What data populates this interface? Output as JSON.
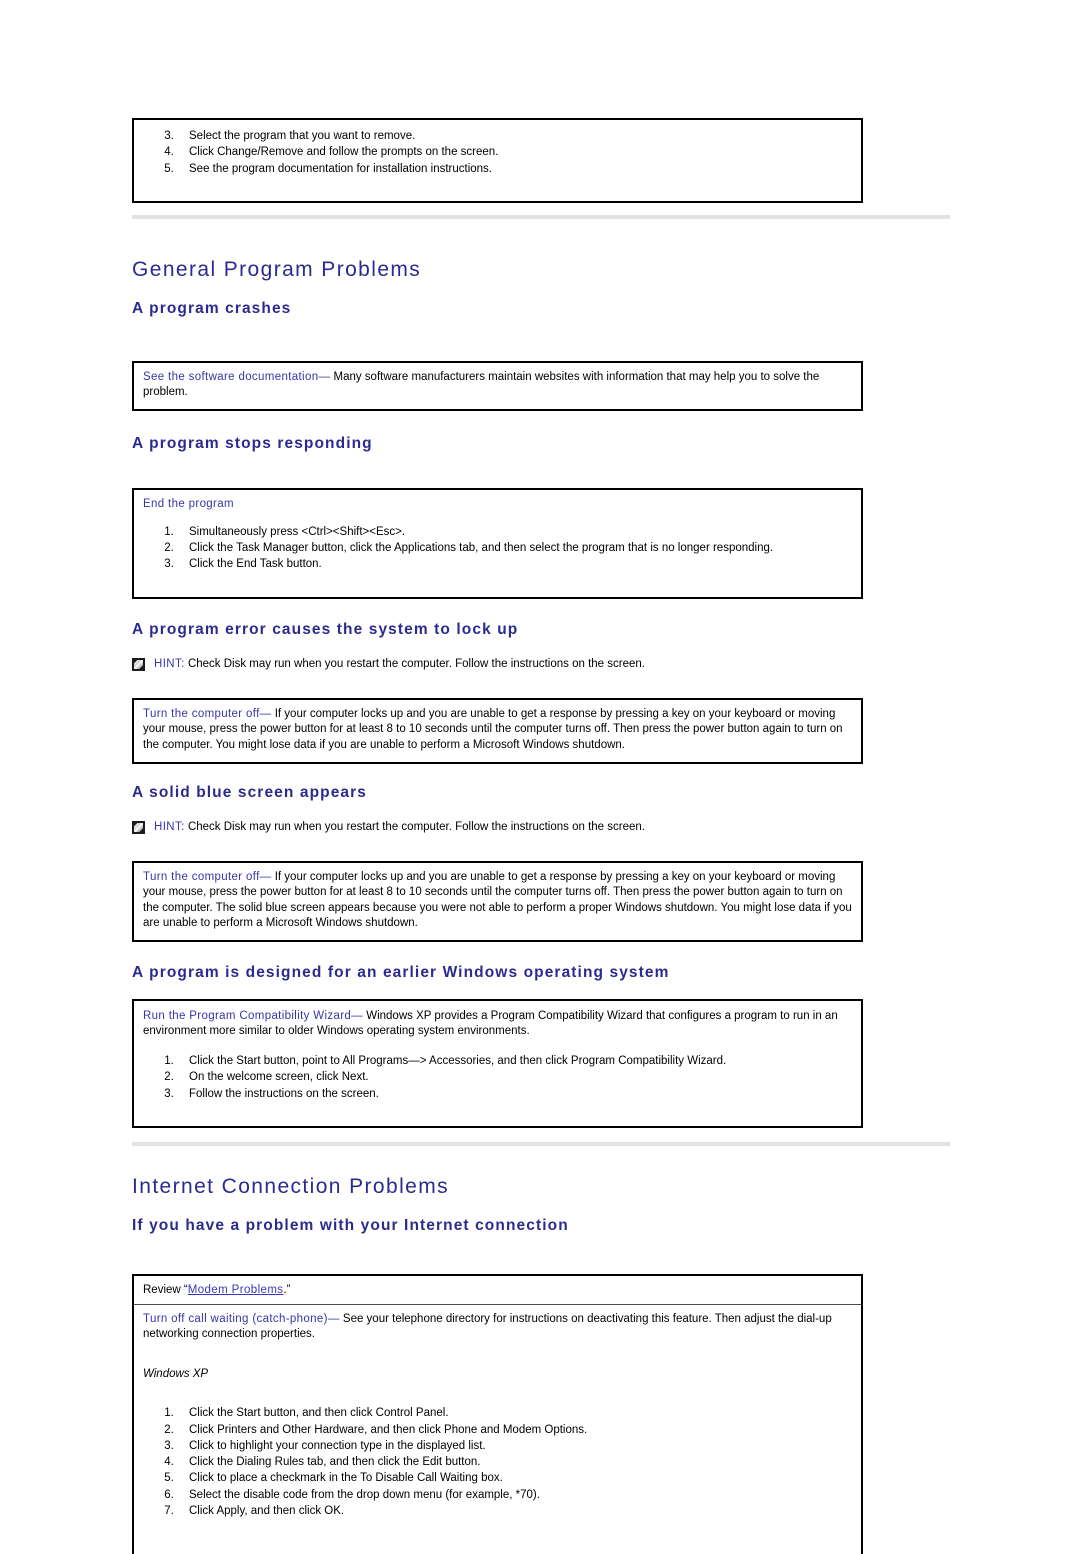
{
  "top_box": {
    "start_number": 3,
    "steps": [
      "Select the program that you want to remove.",
      "Click Change/Remove and follow the prompts on the screen.",
      "See the program documentation for installation instructions."
    ]
  },
  "section_general": {
    "title": "General Program Problems",
    "sub_crashes": {
      "title": "A program crashes",
      "box": {
        "runin": "See the software documentation",
        "dash": "—",
        "text": " Many software manufacturers maintain websites with information that may help you to solve the problem."
      }
    },
    "sub_stops_responding": {
      "title": "A program stops responding",
      "box": {
        "title": "End the program",
        "steps": [
          "Simultaneously press <Ctrl><Shift><Esc>.",
          "Click the Task Manager button, click the Applications tab, and then select the program that is no longer responding.",
          "Click the End Task button."
        ]
      }
    },
    "sub_lock_up": {
      "title": "A program error causes the system to lock up",
      "hint": {
        "label": "HINT:",
        "text": " Check Disk may run when you restart the computer. Follow the instructions on the screen."
      },
      "box": {
        "runin": "Turn the computer off",
        "dash": "—",
        "text": " If your computer locks up and you are unable to get a response by pressing a key on your keyboard or moving your mouse, press the power button for at least 8 to 10 seconds until the computer turns off. Then press the power button again to turn on the computer. You might lose data if you are unable to perform a Microsoft Windows shutdown."
      }
    },
    "sub_blue_screen": {
      "title": "A solid blue screen appears",
      "hint": {
        "label": "HINT:",
        "text": " Check Disk may run when you restart the computer. Follow the instructions on the screen."
      },
      "box": {
        "runin": "Turn the computer off",
        "dash": "—",
        "text": " If your computer locks up and you are unable to get a response by pressing a key on your keyboard or moving your mouse, press the power button for at least 8 to 10 seconds until the computer turns off. Then press the power button again to turn on the computer. The solid blue screen appears because you were not able to perform a proper Windows shutdown. You might lose data if you are unable to perform a Microsoft Windows shutdown."
      }
    },
    "sub_earlier_windows": {
      "title": "A program is designed for an earlier Windows operating system",
      "box": {
        "runin": "Run the Program Compatibility Wizard",
        "dash": "—",
        "text": " Windows XP provides a Program Compatibility Wizard that configures a program to run in an environment more similar to older Windows operating system environments.",
        "steps": [
          "Click the Start button, point to All Programs—> Accessories, and then click Program Compatibility Wizard.",
          "On the welcome screen, click Next.",
          "Follow the instructions on the screen."
        ]
      }
    }
  },
  "section_internet": {
    "title": "Internet Connection Problems",
    "sub_connection": {
      "title": "If you have a problem with your Internet connection",
      "box": {
        "review_prefix": "Review “",
        "review_link": "Modem Problems",
        "review_suffix": ".”",
        "runin": "Turn off call waiting (catch-phone)",
        "dash": "—",
        "text": " See your telephone directory for instructions on deactivating this feature. Then adjust the dial-up networking connection properties.",
        "os_label": "Windows XP",
        "steps": [
          "Click the Start button, and then click Control Panel.",
          "Click Printers and Other Hardware, and then click Phone and Modem Options.",
          "Click to highlight your connection type in the displayed list.",
          "Click the Dialing Rules tab, and then click the Edit button.",
          "Click to place a checkmark in the To Disable Call Waiting box.",
          "Select the disable code from the drop down menu (for example, *70).",
          "Click Apply, and then click OK."
        ]
      }
    }
  },
  "colors": {
    "heading_blue": "#2b2b8f",
    "runin_blue": "#3636a8",
    "link_blue": "#3636c0",
    "rule_gray": "#e2e2e2",
    "box_border": "#000000"
  }
}
